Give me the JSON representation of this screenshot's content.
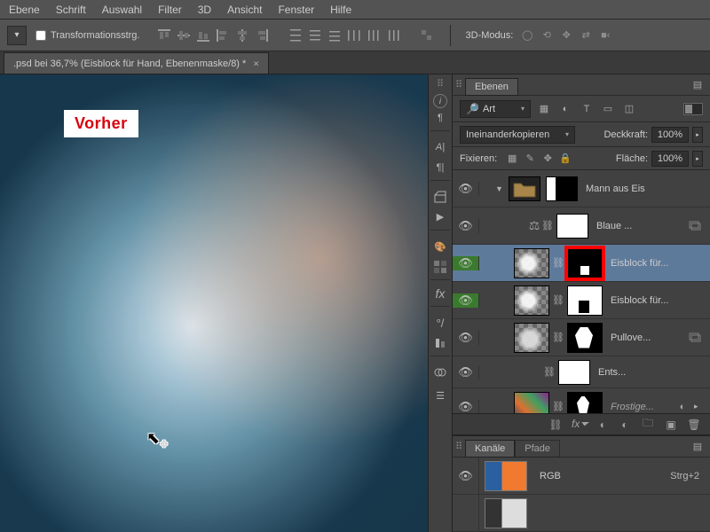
{
  "menu": {
    "items": [
      "Ebene",
      "Schrift",
      "Auswahl",
      "Filter",
      "3D",
      "Ansicht",
      "Fenster",
      "Hilfe"
    ]
  },
  "options": {
    "transform_checkbox": "Transformationsstrg.",
    "mode3d_label": "3D-Modus:"
  },
  "document": {
    "tab_title": ".psd bei 36,7% (Eisblock für Hand, Ebenenmaske/8) *"
  },
  "canvas": {
    "annotation": "Vorher"
  },
  "panels": {
    "layers_tab": "Ebenen",
    "filter_label": "Art",
    "blend_mode": "Ineinanderkopieren",
    "opacity_label": "Deckkraft:",
    "opacity_value": "100%",
    "lock_label": "Fixieren:",
    "fill_label": "Fläche:",
    "fill_value": "100%",
    "channels_tab": "Kanäle",
    "paths_tab": "Pfade"
  },
  "layers": [
    {
      "type": "group",
      "name": "Mann aus Eis",
      "eye": true,
      "green": false,
      "open": true,
      "mask": "silhouette"
    },
    {
      "type": "adjust",
      "name": "Blaue ...",
      "eye": true,
      "green": false,
      "variant": "balance"
    },
    {
      "type": "smart",
      "name": "Eisblock für...",
      "eye": true,
      "green": true,
      "selected": true,
      "highlight": true,
      "mask": "dark"
    },
    {
      "type": "smart",
      "name": "Eisblock für...",
      "eye": true,
      "green": true,
      "mask": "white-shape"
    },
    {
      "type": "smart",
      "name": "Pullove...",
      "eye": true,
      "green": false,
      "mask": "pullover"
    },
    {
      "type": "layer",
      "name": "Ents...",
      "eye": true,
      "mask": "white-plain"
    },
    {
      "type": "layer",
      "name": "Frostige...",
      "eye": true,
      "colorful": true,
      "mask": "figure",
      "adv": true
    }
  ],
  "channels": [
    {
      "name": "RGB",
      "shortcut": "Strg+2",
      "eye": true,
      "color": true
    },
    {
      "name": "",
      "shortcut": "",
      "eye": false,
      "color": false
    }
  ]
}
